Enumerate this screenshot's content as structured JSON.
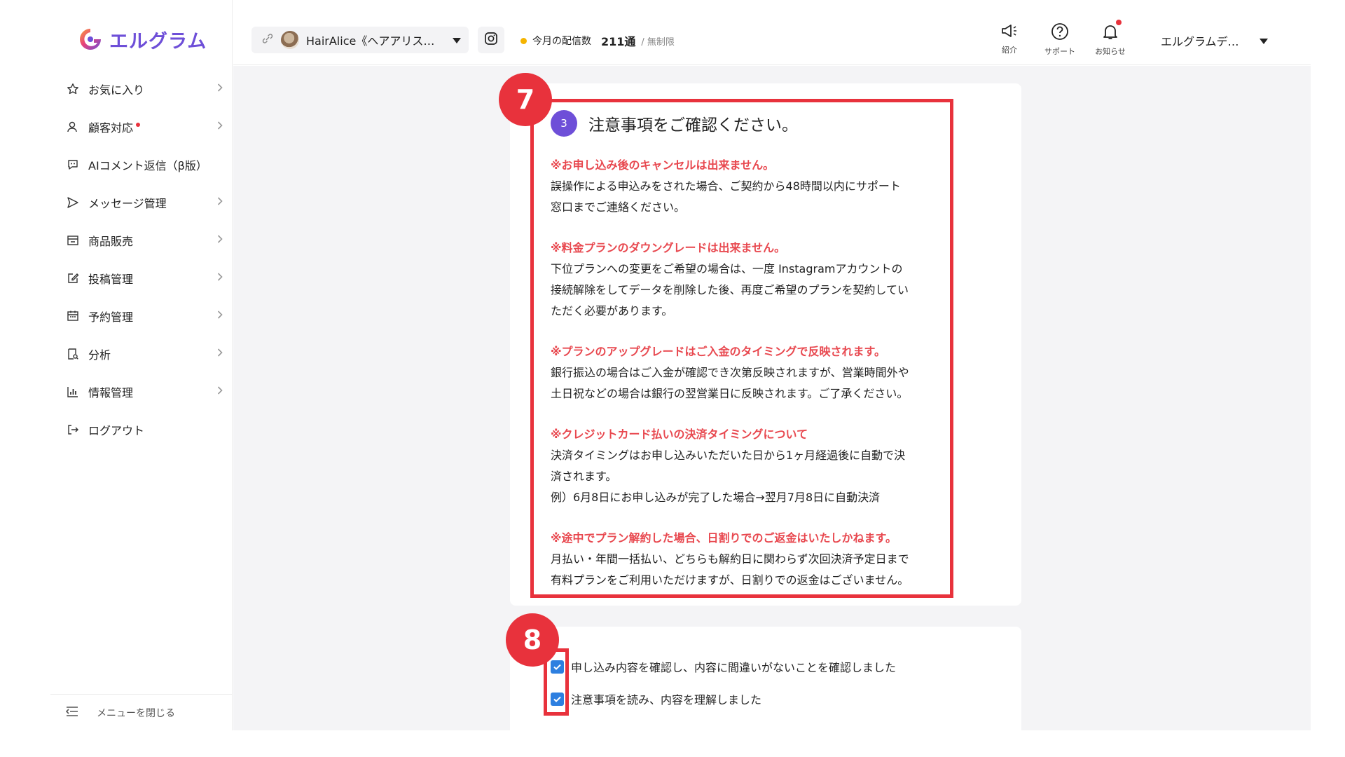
{
  "brand": {
    "logo_text": "エルグラム",
    "accent": "#6e4fd8"
  },
  "sidebar": {
    "items": [
      {
        "icon": "star-icon",
        "label": "お気に入り",
        "chevron": true,
        "dot": false
      },
      {
        "icon": "person-icon",
        "label": "顧客対応",
        "chevron": true,
        "dot": true
      },
      {
        "icon": "ai-chat-icon",
        "label": "AIコメント返信（β版）",
        "chevron": false,
        "dot": false
      },
      {
        "icon": "send-icon",
        "label": "メッセージ管理",
        "chevron": true,
        "dot": false
      },
      {
        "icon": "store-icon",
        "label": "商品販売",
        "chevron": true,
        "dot": false
      },
      {
        "icon": "edit-icon",
        "label": "投稿管理",
        "chevron": true,
        "dot": false
      },
      {
        "icon": "calendar-icon",
        "label": "予約管理",
        "chevron": true,
        "dot": false
      },
      {
        "icon": "analysis-icon",
        "label": "分析",
        "chevron": true,
        "dot": false
      },
      {
        "icon": "bar-chart-icon",
        "label": "情報管理",
        "chevron": true,
        "dot": false
      },
      {
        "icon": "logout-icon",
        "label": "ログアウト",
        "chevron": false,
        "dot": false
      }
    ],
    "collapse_label": "メニューを閉じる"
  },
  "header": {
    "account_name": "HairAlice《ヘアアリス…",
    "delivery_label": "今月の配信数",
    "delivery_count": "211通",
    "delivery_limit": "/ 無制限",
    "intro_label": "紹介",
    "support_label": "サポート",
    "notice_label": "お知らせ",
    "user_name": "エルグラムデ…"
  },
  "annotations": {
    "badge7": "7",
    "badge8": "8"
  },
  "notes": {
    "step": "3",
    "title": "注意事項をご確認ください。",
    "items": [
      {
        "heading": "※お申し込み後のキャンセルは出来ません。",
        "lines": [
          "誤操作による申込みをされた場合、ご契約から48時間以内にサポート",
          "窓口までご連絡ください。"
        ]
      },
      {
        "heading": "※料金プランのダウングレードは出来ません。",
        "lines": [
          "下位プランへの変更をご希望の場合は、一度 Instagramアカウントの",
          "接続解除をしてデータを削除した後、再度ご希望のプランを契約してい",
          "ただく必要があります。"
        ]
      },
      {
        "heading": "※プランのアップグレードはご入金のタイミングで反映されます。",
        "lines": [
          "銀行振込の場合はご入金が確認でき次第反映されますが、営業時間外や",
          "土日祝などの場合は銀行の翌営業日に反映されます。ご了承ください。"
        ]
      },
      {
        "heading": "※クレジットカード払いの決済タイミングについて",
        "lines": [
          "決済タイミングはお申し込みいただいた日から1ヶ月経過後に自動で決",
          "済されます。",
          "例）6月8日にお申し込みが完了した場合→翌月7月8日に自動決済"
        ]
      },
      {
        "heading": "※途中でプラン解約した場合、日割りでのご返金はいたしかねます。",
        "lines": [
          "月払い・年間一括払い、どちらも解約日に関わらず次回決済予定日まで",
          "有料プランをご利用いただけますが、日割りでの返金はございません。"
        ]
      }
    ]
  },
  "checks": [
    {
      "label": "申し込み内容を確認し、内容に間違いがないことを確認しました",
      "checked": true
    },
    {
      "label": "注意事項を読み、内容を理解しました",
      "checked": true
    }
  ]
}
